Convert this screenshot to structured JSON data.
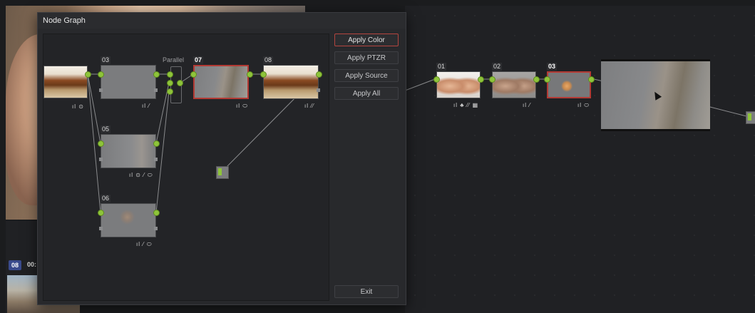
{
  "panel": {
    "title": "Node Graph",
    "buttons": {
      "apply_color": "Apply Color",
      "apply_ptzr": "Apply PTZR",
      "apply_source": "Apply Source",
      "apply_all": "Apply All",
      "exit": "Exit"
    },
    "parallel_label": "Parallel",
    "nodes": [
      {
        "label": "",
        "tools": "ıl ⊙"
      },
      {
        "label": "03",
        "tools": "ıl ⁄"
      },
      {
        "label": "07",
        "tools": "ıl ⬭"
      },
      {
        "label": "08",
        "tools": "ıl ⁄⁄"
      },
      {
        "label": "05",
        "tools": "ıl ⊙ ⁄ ⬭"
      },
      {
        "label": "06",
        "tools": "ıl ⁄ ⬭"
      }
    ]
  },
  "right_graph": {
    "nodes": [
      {
        "label": "01",
        "tools": "ıl ♣ ⁄⁄ ▦"
      },
      {
        "label": "02",
        "tools": "ıl ⁄"
      },
      {
        "label": "03",
        "tools": "ıl ⬭"
      }
    ]
  },
  "clip": {
    "badge": "08",
    "timecode": "00:"
  },
  "colors": {
    "accent_red": "#b33a34",
    "connector_green": "#8ec43a"
  }
}
